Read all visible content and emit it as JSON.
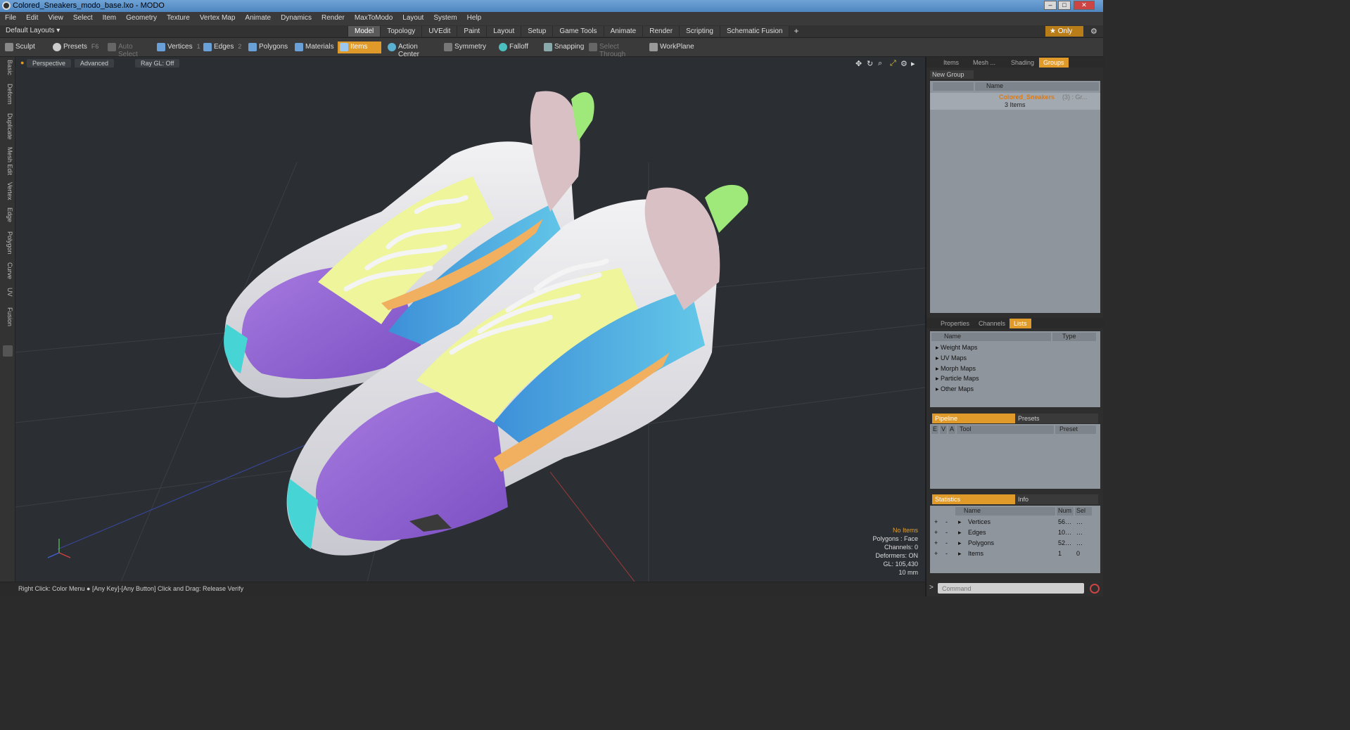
{
  "window": {
    "title": "Colored_Sneakers_modo_base.lxo - MODO",
    "min": "–",
    "max": "□",
    "close": "✕"
  },
  "menu": [
    "File",
    "Edit",
    "View",
    "Select",
    "Item",
    "Geometry",
    "Texture",
    "Vertex Map",
    "Animate",
    "Dynamics",
    "Render",
    "MaxToModo",
    "Layout",
    "System",
    "Help"
  ],
  "layouts": {
    "default_layouts": "Default Layouts ▾",
    "tabs": [
      "Model",
      "Topology",
      "UVEdit",
      "Paint",
      "Layout",
      "Setup",
      "Game Tools",
      "Animate",
      "Render",
      "Scripting",
      "Schematic Fusion"
    ],
    "active_tab": "Model",
    "plus": "+",
    "only": "★ Only"
  },
  "toolbar": {
    "sculpt": "Sculpt",
    "presets": "Presets",
    "presets_hotkey": "F6",
    "auto_select": "Auto Select",
    "vertices": "Vertices",
    "vertices_hotkey": "1",
    "edges": "Edges",
    "edges_hotkey": "2",
    "polygons": "Polygons",
    "materials": "Materials",
    "items": "Items",
    "action_center": "Action Center",
    "symmetry": "Symmetry",
    "falloff": "Falloff",
    "snapping": "Snapping",
    "select_through": "Select Through",
    "workplane": "WorkPlane"
  },
  "left_tabs": [
    "Basic",
    "Deform",
    "Duplicate",
    "Mesh Edit",
    "Vertex",
    "Edge",
    "Polygon",
    "Curve",
    "UV",
    "Fusion"
  ],
  "viewport": {
    "perspective": "Perspective",
    "advanced": "Advanced",
    "raygl": "Ray GL: Off",
    "stats": {
      "no_items": "No Items",
      "polygons": "Polygons : Face",
      "channels": "Channels: 0",
      "deformers": "Deformers: ON",
      "gl": "GL: 105,430",
      "scale": "10 mm"
    }
  },
  "status": "Right Click: Color Menu ● [Any Key]-[Any Button] Click and Drag: Release Verify",
  "groups_panel": {
    "tabs": [
      "Items",
      "Mesh ...",
      "Shading",
      "Groups"
    ],
    "active": "Groups",
    "new_group": "New Group",
    "name_header": "Name",
    "group_name": "Colored_Sneakers",
    "group_count": "(3) : Gr...",
    "group_items": "3 Items"
  },
  "lists_panel": {
    "tabs": [
      "Properties",
      "Channels",
      "Lists"
    ],
    "active": "Lists",
    "name_header": "Name",
    "type_header": "Type",
    "rows": [
      "Weight Maps",
      "UV Maps",
      "Morph Maps",
      "Particle Maps",
      "Other Maps"
    ]
  },
  "pipeline_panel": {
    "tab_active": "Pipeline",
    "tab_other": "Presets",
    "col_e": "E",
    "col_v": "V",
    "col_a": "A",
    "col_tool": "Tool",
    "col_preset": "Preset"
  },
  "stats_panel": {
    "tab_active": "Statistics",
    "tab_other": "Info",
    "name_header": "Name",
    "num_header": "Num",
    "sel_header": "Sel",
    "rows": [
      {
        "name": "Vertices",
        "num": "56…",
        "sel": "…"
      },
      {
        "name": "Edges",
        "num": "10…",
        "sel": "…"
      },
      {
        "name": "Polygons",
        "num": "52…",
        "sel": "…"
      },
      {
        "name": "Items",
        "num": "1",
        "sel": "0"
      }
    ]
  },
  "command": {
    "placeholder": "Command"
  }
}
